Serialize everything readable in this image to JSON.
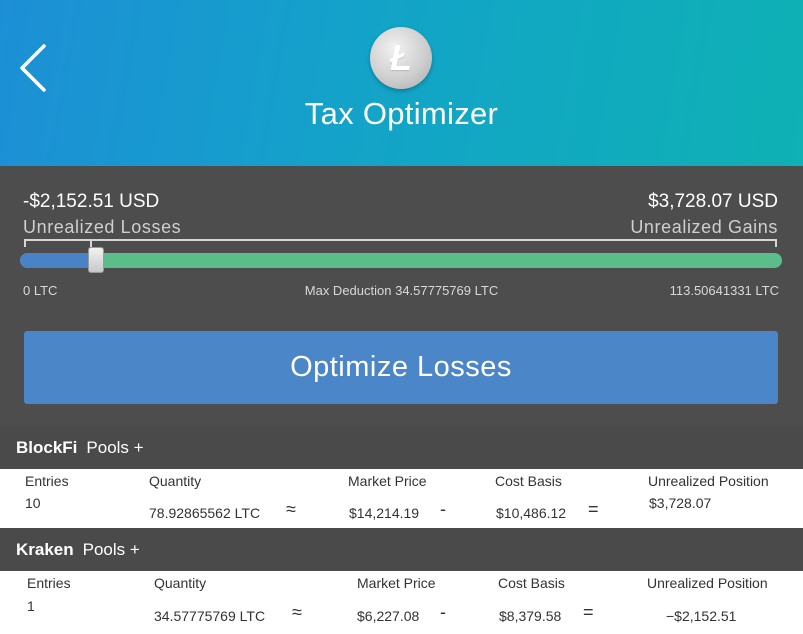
{
  "header": {
    "title": "Tax Optimizer",
    "coin_logo_letter": "Ł",
    "gradient": [
      "#1d8fd6",
      "#0eb1b4"
    ]
  },
  "summary": {
    "losses_value": "-$2,152.51 USD",
    "losses_label": "Unrealized Losses",
    "gains_value": "$3,728.07 USD",
    "gains_label": "Unrealized Gains"
  },
  "slider": {
    "min_label": "0 LTC",
    "max_deduction_label": "Max Deduction 34.57775769  LTC",
    "max_label": "113.50641331  LTC",
    "level_fraction": 0.1,
    "fill_color": "#4a82c7",
    "track_color": "#5bbd89"
  },
  "optimize_button_label": "Optimize Losses",
  "column_headers": {
    "entries": "Entries",
    "quantity": "Quantity",
    "market_price": "Market Price",
    "cost_basis": "Cost Basis",
    "unrealized_position": "Unrealized Position"
  },
  "operators": {
    "approx": "≈",
    "minus": "-",
    "equals": "="
  },
  "pools": [
    {
      "name": "BlockFi",
      "pools_link": "Pools +",
      "entries": "10",
      "quantity": "78.92865562  LTC",
      "market_price": "$14,214.19",
      "cost_basis": "$10,486.12",
      "unrealized_position": "$3,728.07"
    },
    {
      "name": "Kraken",
      "pools_link": "Pools +",
      "entries": "1",
      "quantity": "34.57775769  LTC",
      "market_price": "$6,227.08",
      "cost_basis": "$8,379.58",
      "unrealized_position": "−$2,152.51"
    }
  ]
}
